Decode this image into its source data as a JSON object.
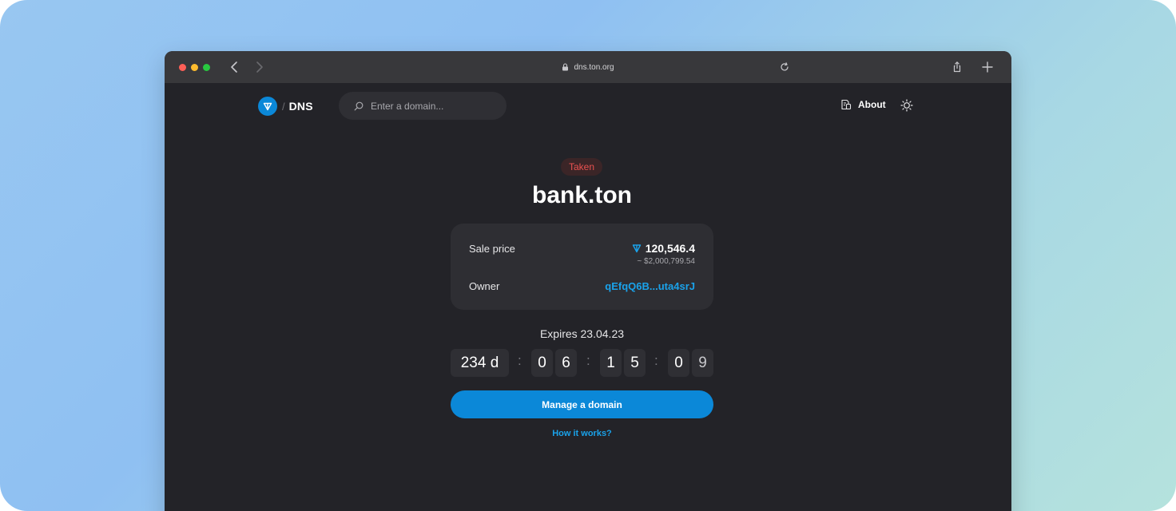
{
  "browser": {
    "url": "dns.ton.org"
  },
  "header": {
    "logo_slash": "/",
    "logo_text": "DNS",
    "search_placeholder": "Enter a domain...",
    "about_label": "About"
  },
  "domain": {
    "status": "Taken",
    "name": "bank.ton",
    "sale_price_label": "Sale price",
    "sale_price_value": "120,546.4",
    "sale_price_usd": "~ $2,000,799.54",
    "owner_label": "Owner",
    "owner_value": "qEfqQ6B...uta4srJ"
  },
  "timer": {
    "expires": "Expires 23.04.23",
    "days": "234 d",
    "separator": ":",
    "hours": [
      "0",
      "6"
    ],
    "minutes": [
      "1",
      "5"
    ],
    "seconds": [
      "0",
      "9"
    ]
  },
  "actions": {
    "manage": "Manage a domain",
    "how": "How it works?"
  },
  "colors": {
    "accent": "#0b88d8",
    "link": "#1aa2ea",
    "taken": "#ea5150",
    "background": "#232328"
  },
  "icons": [
    "lock-icon",
    "back-icon",
    "forward-icon",
    "reload-icon",
    "share-icon",
    "new-tab-icon",
    "ton-logo-icon",
    "search-icon",
    "about-icon",
    "theme-icon",
    "ton-currency-icon"
  ]
}
